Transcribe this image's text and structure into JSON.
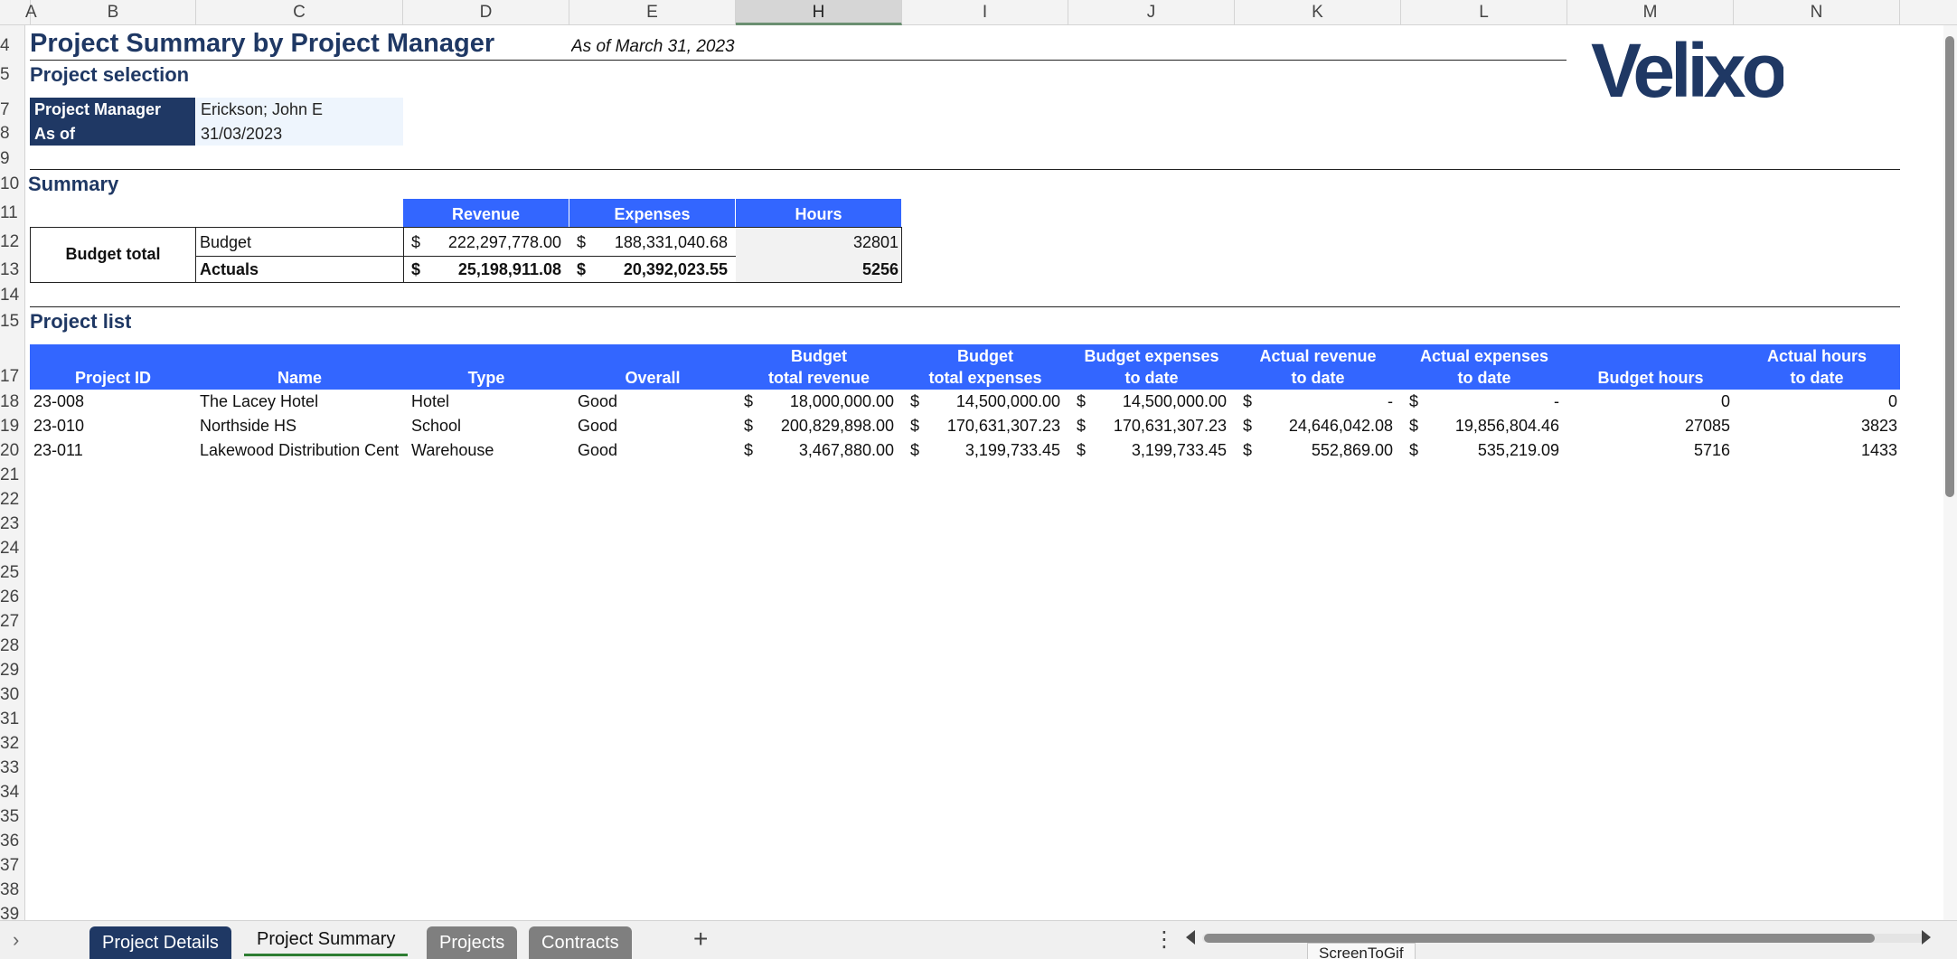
{
  "columns": [
    "A",
    "B",
    "C",
    "D",
    "E",
    "H",
    "I",
    "J",
    "K",
    "L",
    "M",
    "N"
  ],
  "rows": [
    "4",
    "5",
    "7",
    "8",
    "9",
    "10",
    "11",
    "12",
    "13",
    "14",
    "15",
    "17",
    "18",
    "19",
    "20",
    "21",
    "22",
    "23",
    "24",
    "25",
    "26",
    "27",
    "28",
    "29",
    "30",
    "31",
    "32",
    "33",
    "34",
    "35",
    "36",
    "37",
    "38",
    "39"
  ],
  "title": "Project Summary by Project Manager",
  "as_of_text": "As of March 31, 2023",
  "logo_text": "Velixo",
  "selection": {
    "heading": "Project selection",
    "pm_label": "Project Manager",
    "pm_value": "Erickson; John E",
    "asof_label": "As of",
    "asof_value": "31/03/2023"
  },
  "summary": {
    "heading": "Summary",
    "headers": [
      "Revenue",
      "Expenses",
      "Hours"
    ],
    "group_label": "Budget total",
    "rows": [
      {
        "label": "Budget",
        "revenue": "222,297,778.00",
        "expenses": "188,331,040.68",
        "hours": "32801"
      },
      {
        "label": "Actuals",
        "revenue": "25,198,911.08",
        "expenses": "20,392,023.55",
        "hours": "5256"
      }
    ],
    "currency": "$"
  },
  "project_list": {
    "heading": "Project list",
    "headers": [
      {
        "l1": "",
        "l2": "Project ID"
      },
      {
        "l1": "",
        "l2": "Name"
      },
      {
        "l1": "",
        "l2": "Type"
      },
      {
        "l1": "",
        "l2": "Overall"
      },
      {
        "l1": "Budget",
        "l2": "total revenue"
      },
      {
        "l1": "Budget",
        "l2": "total expenses"
      },
      {
        "l1": "Budget expenses",
        "l2": "to date"
      },
      {
        "l1": "Actual revenue",
        "l2": "to date"
      },
      {
        "l1": "Actual expenses",
        "l2": "to date"
      },
      {
        "l1": "",
        "l2": "Budget hours"
      },
      {
        "l1": "Actual hours",
        "l2": "to date"
      }
    ],
    "rows": [
      {
        "id": "23-008",
        "name": "The Lacey Hotel",
        "type": "Hotel",
        "overall": "Good",
        "btr": "18,000,000.00",
        "bte": "14,500,000.00",
        "bed": "14,500,000.00",
        "ard": "-",
        "aed": "-",
        "bh": "0",
        "ah": "0"
      },
      {
        "id": "23-010",
        "name": "Northside HS",
        "type": "School",
        "overall": "Good",
        "btr": "200,829,898.00",
        "bte": "170,631,307.23",
        "bed": "170,631,307.23",
        "ard": "24,646,042.08",
        "aed": "19,856,804.46",
        "bh": "27085",
        "ah": "3823"
      },
      {
        "id": "23-011",
        "name": "Lakewood Distribution Cent",
        "type": "Warehouse",
        "overall": "Good",
        "btr": "3,467,880.00",
        "bte": "3,199,733.45",
        "bed": "3,199,733.45",
        "ard": "552,869.00",
        "aed": "535,219.09",
        "bh": "5716",
        "ah": "1433"
      }
    ]
  },
  "tabs": [
    {
      "label": "Project Details",
      "style": "navy"
    },
    {
      "label": "Project Summary",
      "style": "active"
    },
    {
      "label": "Projects",
      "style": "gray"
    },
    {
      "label": "Contracts",
      "style": "gray"
    }
  ],
  "add_sheet": "+",
  "tooltip": "ScreenToGif"
}
